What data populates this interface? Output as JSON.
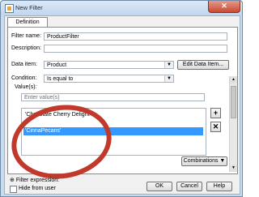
{
  "window": {
    "title": "New Filter",
    "close_label": "✕"
  },
  "tab": {
    "definition": "Definition"
  },
  "form": {
    "filter_name_label": "Filter name:",
    "filter_name_value": "ProductFilter",
    "description_label": "Description:",
    "description_value": "",
    "data_item_label": "Data item:",
    "data_item_value": "Product",
    "edit_data_item_button": "Edit Data Item...",
    "condition_label": "Condition:",
    "condition_value": "Is equal to",
    "values_label": "Value(s):",
    "enter_values_placeholder": "Enter value(s)"
  },
  "values_list": [
    "'Chocolate Cherry Delight'",
    "'CinnaPecans'"
  ],
  "list_buttons": {
    "add": "+",
    "remove": "✕"
  },
  "combinations_button": "Combinations ▼",
  "filter_expression_label": "Filter expression:",
  "hide_from_user_label": "Hide from user",
  "footer": {
    "ok": "OK",
    "cancel": "Cancel",
    "help": "Help"
  },
  "annotation_color": "#c0392b"
}
